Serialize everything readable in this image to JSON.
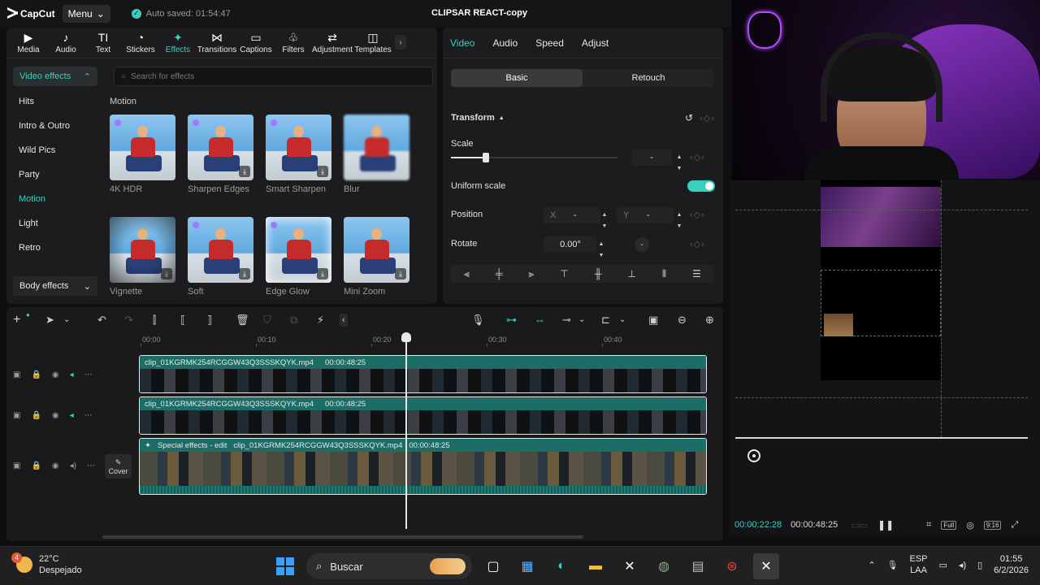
{
  "app": {
    "logo": "CapCut",
    "menu": "Menu",
    "autosave": "Auto saved: 01:54:47",
    "project_title": "CLIPSAR REACT-copy"
  },
  "tools": [
    {
      "label": "Media",
      "icon": "▶"
    },
    {
      "label": "Audio",
      "icon": "♪"
    },
    {
      "label": "Text",
      "icon": "TI"
    },
    {
      "label": "Stickers",
      "icon": "◔"
    },
    {
      "label": "Effects",
      "icon": "✦"
    },
    {
      "label": "Transitions",
      "icon": "⋈"
    },
    {
      "label": "Captions",
      "icon": "▭"
    },
    {
      "label": "Filters",
      "icon": "♧"
    },
    {
      "label": "Adjustment",
      "icon": "⇄"
    },
    {
      "label": "Templates",
      "icon": "◫"
    }
  ],
  "sidebar": {
    "header": "Video effects",
    "items": [
      "Hits",
      "Intro & Outro",
      "Wild Pics",
      "Party",
      "Motion",
      "Light",
      "Retro"
    ],
    "footer": "Body effects"
  },
  "search": {
    "placeholder": "Search for effects"
  },
  "effects": {
    "section": "Motion",
    "cards": [
      "4K HDR",
      "Sharpen Edges",
      "Smart Sharpen",
      "Blur",
      "Vignette",
      "Soft",
      "Edge Glow",
      "Mini Zoom"
    ]
  },
  "props": {
    "tabs": [
      "Video",
      "Audio",
      "Speed",
      "Adjust"
    ],
    "segments": [
      "Basic",
      "Retouch"
    ],
    "transform": "Transform",
    "scale_label": "Scale",
    "scale_value": "-",
    "uniform_scale": "Uniform scale",
    "position_label": "Position",
    "pos_x_label": "X",
    "pos_x_value": "-",
    "pos_y_label": "Y",
    "pos_y_value": "-",
    "rotate_label": "Rotate",
    "rotate_value": "0.00°",
    "rotate_dial": "-"
  },
  "preview": {
    "current_time": "00:00:22:28",
    "total_time": "00:00:48:25",
    "full": "Full",
    "ratio": "9:16"
  },
  "timeline": {
    "ruler": [
      "00:00",
      "00:10",
      "00:20",
      "00:30",
      "00:40"
    ],
    "tracks": [
      {
        "label": "clip_01KGRMK254RCGGW43Q3SSSKQYK.mp4",
        "duration": "00:00:48:25"
      },
      {
        "label": "clip_01KGRMK254RCGGW43Q3SSSKQYK.mp4",
        "duration": "00:00:48:25"
      },
      {
        "prefix": "Special effects - edit",
        "label": "clip_01KGRMK254RCGGW43Q3SSSKQYK.mp4",
        "duration": "00:00:48:25"
      }
    ],
    "cover": "Cover"
  },
  "taskbar": {
    "badge": "4",
    "temp": "22°C",
    "weather": "Despejado",
    "search": "Buscar",
    "lang1": "ESP",
    "lang2": "LAA",
    "time": "01:55",
    "date": "6/2/2026"
  },
  "colors": {
    "accent": "#3ad0c0",
    "panel": "#1c1c1e",
    "track_head": "#1c6d66"
  }
}
